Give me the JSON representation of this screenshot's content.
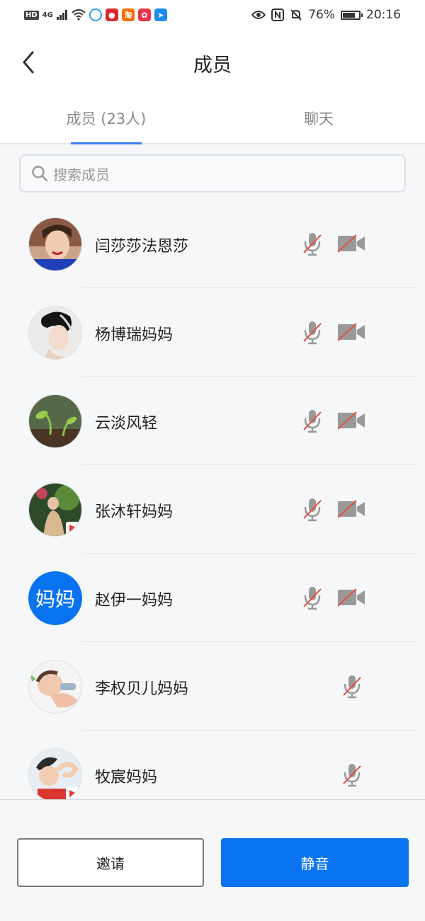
{
  "status_bar": {
    "hd": "HD",
    "signal": "4G",
    "battery": "76%",
    "battery_level": 0.76,
    "time": "20:16"
  },
  "header": {
    "title": "成员"
  },
  "tabs": [
    {
      "label": "成员 (23人)",
      "active": true
    },
    {
      "label": "聊天",
      "active": false
    }
  ],
  "search": {
    "placeholder": "搜索成员"
  },
  "members": [
    {
      "name": "闫莎莎法恩莎",
      "mic_muted": true,
      "camera_off": true,
      "avatar": "photo-woman-red-lips"
    },
    {
      "name": "杨博瑞妈妈",
      "mic_muted": true,
      "camera_off": true,
      "avatar": "photo-woman-profile"
    },
    {
      "name": "云淡风轻",
      "mic_muted": true,
      "camera_off": true,
      "avatar": "photo-sprout"
    },
    {
      "name": "张沐轩妈妈",
      "mic_muted": true,
      "camera_off": true,
      "avatar": "photo-girl-dress"
    },
    {
      "name": "赵伊一妈妈",
      "mic_muted": true,
      "camera_off": true,
      "avatar_text": "妈妈"
    },
    {
      "name": "李权贝儿妈妈",
      "mic_muted": true,
      "camera_off": null,
      "avatar": "photo-baby"
    },
    {
      "name": "牧宸妈妈",
      "mic_muted": true,
      "camera_off": null,
      "avatar": "photo-child-hat"
    }
  ],
  "footer": {
    "invite_label": "邀请",
    "mute_label": "静音"
  },
  "colors": {
    "accent": "#0a74f0",
    "tab_underline": "#3d7cf2",
    "muted_slash": "#e2523f",
    "icon_gray": "#999999"
  }
}
